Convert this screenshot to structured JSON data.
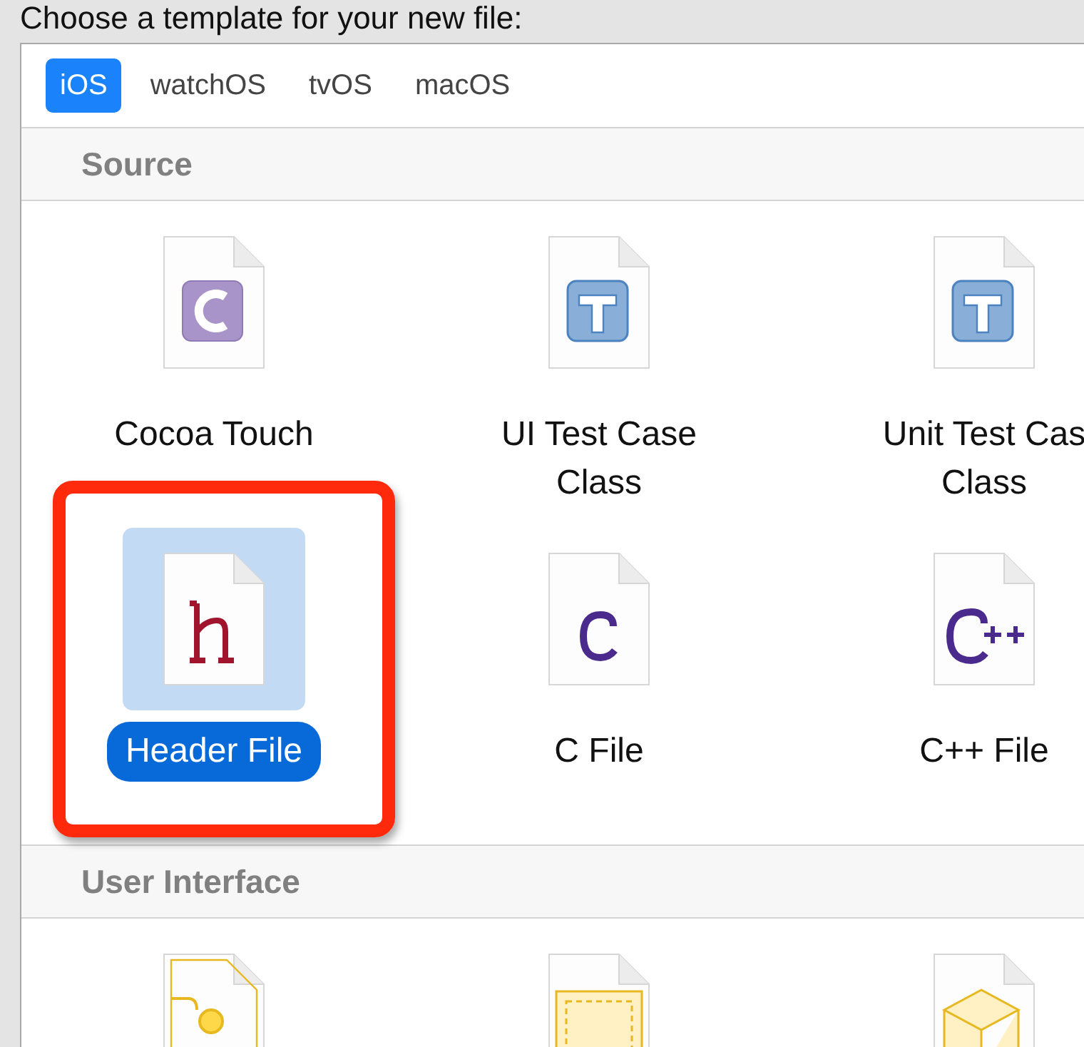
{
  "prompt": "Choose a template for your new file:",
  "tabs": [
    {
      "label": "iOS",
      "selected": true
    },
    {
      "label": "watchOS",
      "selected": false
    },
    {
      "label": "tvOS",
      "selected": false
    },
    {
      "label": "macOS",
      "selected": false
    }
  ],
  "sections": [
    {
      "title": "Source",
      "items": [
        {
          "kind": "class",
          "label_lines": [
            "Cocoa Touch"
          ],
          "selected": false,
          "annotated": false
        },
        {
          "kind": "test",
          "label_lines": [
            "UI Test Case",
            "Class"
          ],
          "selected": false,
          "annotated": false
        },
        {
          "kind": "test",
          "label_lines": [
            "Unit Test Cas",
            "Class"
          ],
          "selected": false,
          "annotated": false
        },
        {
          "kind": "header",
          "label_lines": [
            "Header File"
          ],
          "selected": true,
          "annotated": true
        },
        {
          "kind": "c",
          "label_lines": [
            "C File"
          ],
          "selected": false,
          "annotated": false
        },
        {
          "kind": "cpp",
          "label_lines": [
            "C++ File"
          ],
          "selected": false,
          "annotated": false
        }
      ]
    },
    {
      "title": "User Interface",
      "items": [
        {
          "kind": "storyboard",
          "selected": false,
          "annotated": false
        },
        {
          "kind": "view",
          "selected": false,
          "annotated": false
        },
        {
          "kind": "empty",
          "selected": false,
          "annotated": false
        }
      ]
    }
  ]
}
